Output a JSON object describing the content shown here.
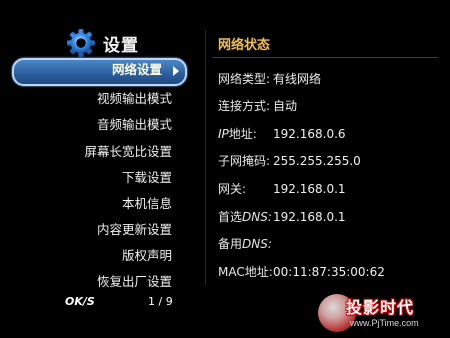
{
  "header": {
    "title": "设置",
    "icon": "gear-icon"
  },
  "menu": {
    "items": [
      {
        "label": "网络设置",
        "selected": true
      },
      {
        "label": "视频输出模式"
      },
      {
        "label": "音频输出模式"
      },
      {
        "label": "屏幕长宽比设置"
      },
      {
        "label": "下载设置"
      },
      {
        "label": "本机信息"
      },
      {
        "label": "内容更新设置"
      },
      {
        "label": "版权声明"
      },
      {
        "label": "恢复出厂设置"
      }
    ]
  },
  "footer": {
    "ok_label": "OK/S",
    "page": "1 / 9"
  },
  "panel": {
    "title": "网络状态",
    "rows": [
      {
        "key": "网络类型:",
        "value": "有线网络"
      },
      {
        "key": "连接方式:",
        "value": "自动"
      },
      {
        "key_prefix": "IP",
        "key": "地址:",
        "value": "192.168.0.6"
      },
      {
        "key": "子网掩码:",
        "value": "255.255.255.0"
      },
      {
        "key": "网关:",
        "value": "192.168.0.1"
      },
      {
        "key": "首选",
        "key_suffix": "DNS:",
        "value": "192.168.0.1"
      },
      {
        "key": "备用",
        "key_suffix": "DNS:",
        "value": ""
      },
      {
        "key": "MAC地址:",
        "value": "00:11:87:35:00:62"
      }
    ]
  },
  "watermark": {
    "brand": "投影时代",
    "url": "www.PjTime.com"
  },
  "colors": {
    "accent_gold": "#f5c04a",
    "selection_blue": "#2b5d9c",
    "gear_blue": "#3a8ee8"
  }
}
